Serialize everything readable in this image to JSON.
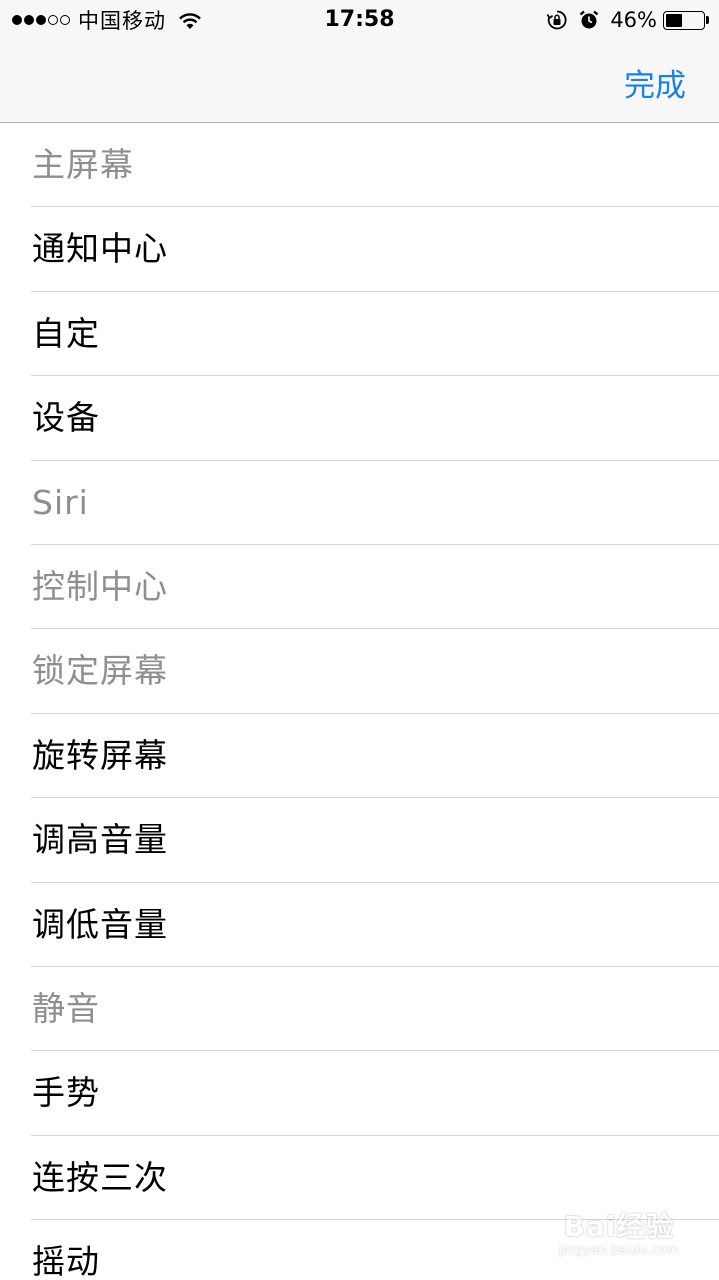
{
  "status_bar": {
    "signal_dots": [
      "full",
      "full",
      "full",
      "empty",
      "empty"
    ],
    "carrier": "中国移动",
    "time": "17:58",
    "battery_percent": "46%",
    "battery_level": 0.46,
    "icons": [
      "wifi-icon",
      "orientation-lock-icon",
      "alarm-icon",
      "battery-icon"
    ]
  },
  "nav": {
    "done_label": "完成",
    "accent_color": "#1a82e2"
  },
  "items": [
    {
      "label": "主屏幕",
      "enabled": false
    },
    {
      "label": "通知中心",
      "enabled": true
    },
    {
      "label": "自定",
      "enabled": true
    },
    {
      "label": "设备",
      "enabled": true
    },
    {
      "label": "Siri",
      "enabled": false
    },
    {
      "label": "控制中心",
      "enabled": false
    },
    {
      "label": "锁定屏幕",
      "enabled": false
    },
    {
      "label": "旋转屏幕",
      "enabled": true
    },
    {
      "label": "调高音量",
      "enabled": true
    },
    {
      "label": "调低音量",
      "enabled": true
    },
    {
      "label": "静音",
      "enabled": false
    },
    {
      "label": "手势",
      "enabled": true
    },
    {
      "label": "连按三次",
      "enabled": true
    },
    {
      "label": "摇动",
      "enabled": true
    }
  ],
  "watermark": {
    "logo": "Bai经验",
    "url": "jingyan.baidu.com"
  }
}
